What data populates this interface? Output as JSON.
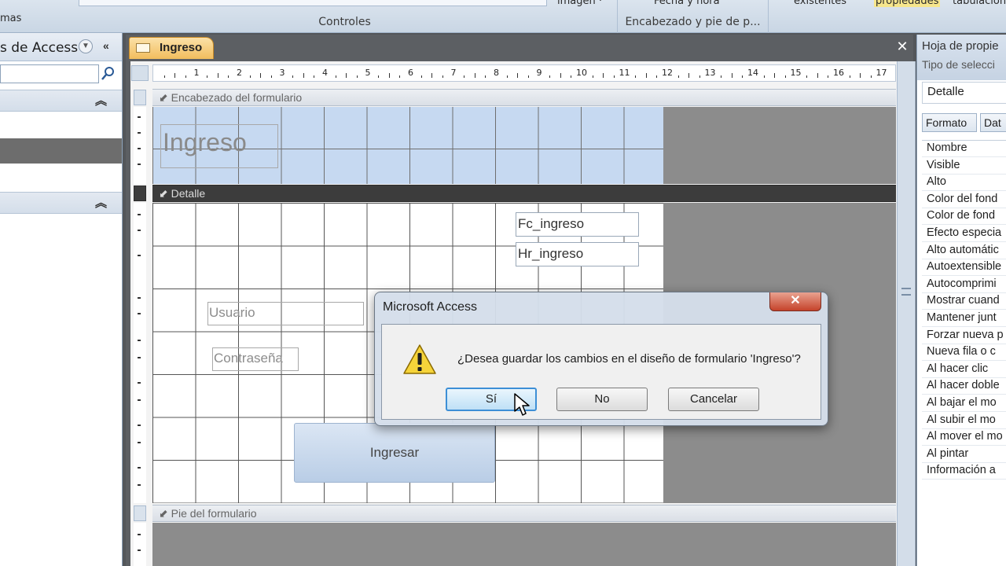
{
  "ribbon": {
    "left_fragment": "mas",
    "group_controles": "Controles",
    "group_encabezado": "Encabezado y pie de p...",
    "top_imagen": "imagen ·",
    "top_fecha": "Fecha y hora",
    "top_existentes": "existentes",
    "top_propiedades": "propiedades",
    "top_tabulacion": "tabulación"
  },
  "nav": {
    "title": "s de Access"
  },
  "document": {
    "tab_label": "Ingreso",
    "close_glyph": "✕",
    "ruler_numbers": [
      "1",
      "2",
      "3",
      "4",
      "5",
      "6",
      "7",
      "8",
      "9",
      "10",
      "11",
      "12",
      "13",
      "14",
      "15",
      "16",
      "17"
    ],
    "sections": {
      "header": "Encabezado del formulario",
      "detail": "Detalle",
      "footer": "Pie del formulario"
    },
    "header_title": "Ingreso",
    "controls": {
      "fc_ingreso": "Fc_ingreso",
      "hr_ingreso": "Hr_ingreso",
      "usuario": "Usuario",
      "contrasena": "Contraseña",
      "ingresar": "Ingresar"
    }
  },
  "props": {
    "title": "Hoja de propie",
    "subtitle": "Tipo de selecci",
    "selection": "Detalle",
    "tabs": [
      "Formato",
      "Dat"
    ],
    "rows": [
      "Nombre",
      "Visible",
      "Alto",
      "Color del fond",
      "Color de fond",
      "Efecto especia",
      "Alto automátic",
      "Autoextensible",
      "Autocomprimi",
      "Mostrar cuand",
      "Mantener junt",
      "Forzar nueva p",
      "Nueva fila o c",
      "Al hacer clic",
      "Al hacer doble",
      "Al bajar el mo",
      "Al subir el mo",
      "Al mover el mo",
      "Al pintar",
      "Información a"
    ]
  },
  "dialog": {
    "title": "Microsoft Access",
    "message": "¿Desea guardar los cambios en el diseño de formulario 'Ingreso'?",
    "buttons": {
      "yes": "Sí",
      "no": "No",
      "cancel": "Cancelar"
    },
    "close_glyph": "✕"
  },
  "colors": {
    "header_band": "#c6d9f1",
    "detail_band": "#ffffff",
    "highlight": "#f6e68c"
  }
}
